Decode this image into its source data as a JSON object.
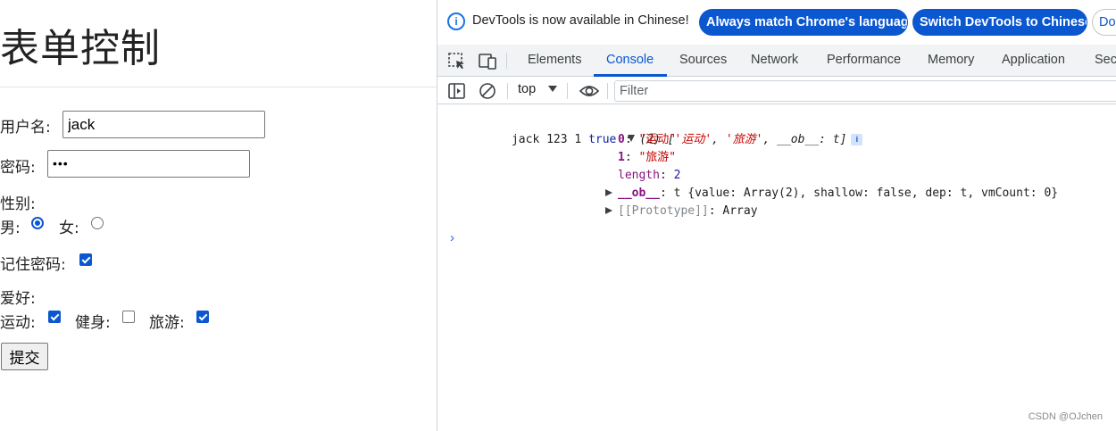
{
  "form": {
    "title": "表单控制",
    "username_label": "用户名:",
    "username_value": "jack",
    "password_label": "密码:",
    "password_masked": "•••",
    "gender_label": "性别:",
    "gender_male": "男:",
    "gender_female": "女:",
    "gender_selected": "男",
    "remember_label": "记住密码:",
    "remember_checked": true,
    "hobbies_label": "爱好:",
    "hobby_sport": "运动:",
    "hobby_fitness": "健身:",
    "hobby_travel": "旅游:",
    "hobby_sport_checked": true,
    "hobby_fitness_checked": false,
    "hobby_travel_checked": true,
    "submit_label": "提交"
  },
  "watermark": "CSDN @OJchen",
  "devtools": {
    "infobar": {
      "message": "DevTools is now available in Chinese!",
      "match_button": "Always match Chrome's language",
      "switch_button": "Switch DevTools to Chinese",
      "dont_button": "Don't show again"
    },
    "tabs": [
      "Elements",
      "Console",
      "Sources",
      "Network",
      "Performance",
      "Memory",
      "Application",
      "Security"
    ],
    "active_tab": "Console",
    "context": "top",
    "filter_placeholder": "Filter",
    "console": {
      "log_plain": "jack 123 1 ",
      "log_bool": "true",
      "array_preview_prefix": "(2) [",
      "array_item0": "'运动'",
      "array_sep": ", ",
      "array_item1": "'旅游'",
      "array_ob": ", __ob__: t]",
      "entry0_key": "0",
      "entry0_value": "\"运动\"",
      "entry1_key": "1",
      "entry1_value": "\"旅游\"",
      "length_key": "length",
      "length_value": "2",
      "ob_key": "__ob__",
      "ob_value": "t {value: Array(2), shallow: false, dep: t, vmCount: 0}",
      "proto_key": "[[Prototype]]",
      "proto_value": "Array"
    }
  },
  "colors": {
    "accent": "#0b57d0",
    "string": "#c80000",
    "key": "#881280",
    "bool": "#0d22aa"
  }
}
